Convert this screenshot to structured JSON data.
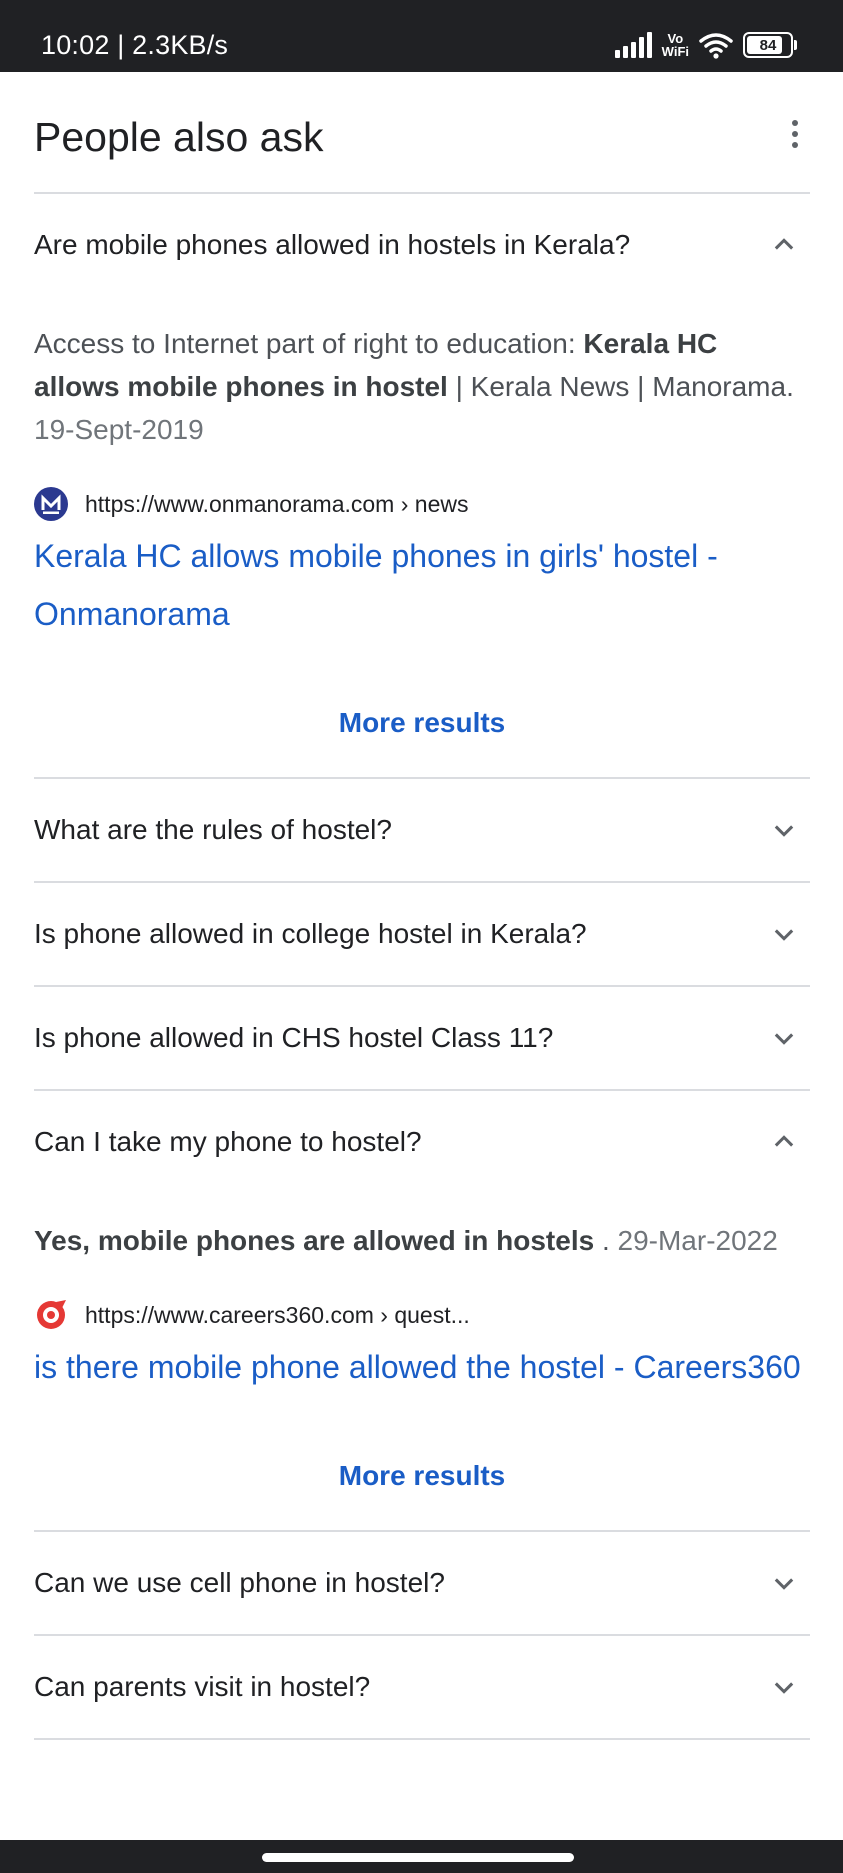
{
  "status_bar": {
    "time_speed": "10:02 | 2.3KB/s",
    "vowifi_line1": "Vo",
    "vowifi_line2": "WiFi",
    "battery": "84",
    "battery_level": 0.84
  },
  "section": {
    "title": "People also ask",
    "menu_icon": "more-vertical-icon"
  },
  "questions": [
    {
      "text": "Are mobile phones allowed in hostels in Kerala?",
      "expanded": true,
      "answer": {
        "pre": "Access to Internet part of right to education: ",
        "bold": "Kerala HC allows mobile phones in hostel",
        "post": " | Kerala News | Manorama.",
        "date": "19-Sept-2019",
        "source_url": "https://www.onmanorama.com › news",
        "link_title": "Kerala HC allows mobile phones in girls' hostel - Onmanorama",
        "favicon_letter": "M",
        "favicon_color": "#2b3990"
      },
      "more": "More results"
    },
    {
      "text": "What are the rules of hostel?",
      "expanded": false
    },
    {
      "text": "Is phone allowed in college hostel in Kerala?",
      "expanded": false
    },
    {
      "text": "Is phone allowed in CHS hostel Class 11?",
      "expanded": false
    },
    {
      "text": "Can I take my phone to hostel?",
      "expanded": true,
      "answer": {
        "pre": "",
        "bold": "Yes, mobile phones are allowed in hostels",
        "post": " .",
        "date": "29-Mar-2022",
        "source_url": "https://www.careers360.com › quest...",
        "link_title": "is there mobile phone allowed the hostel - Careers360",
        "favicon_color": "#e53935"
      },
      "more": "More results"
    },
    {
      "text": "Can we use cell phone in hostel?",
      "expanded": false
    },
    {
      "text": "Can parents visit in hostel?",
      "expanded": false
    }
  ],
  "colors": {
    "link": "#1a5dc6",
    "divider": "#dadce0",
    "statusbar": "#202124"
  }
}
